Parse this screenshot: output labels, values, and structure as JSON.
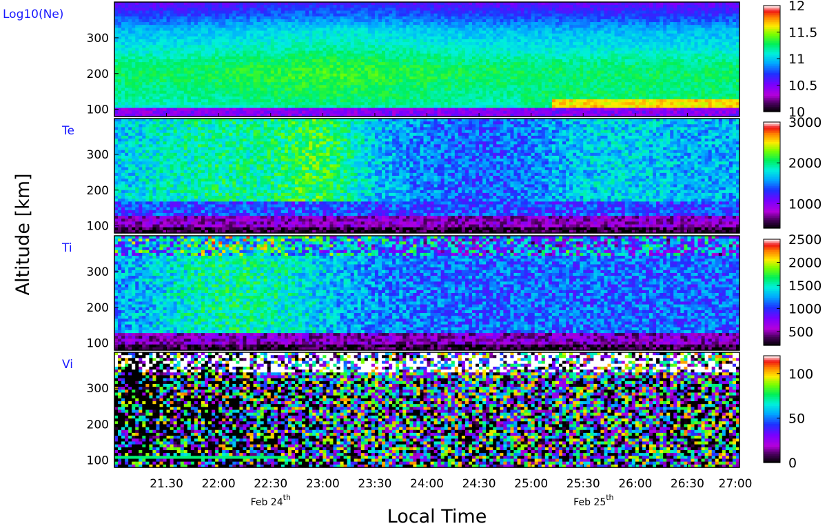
{
  "chart_data": {
    "type": "heatmap",
    "xlabel": "Local Time",
    "ylabel": "Altitude [km]",
    "x_range": [
      "21:00",
      "27:00"
    ],
    "x_ticks": [
      "21.30",
      "22:00",
      "22:30",
      "23:00",
      "23:30",
      "24:00",
      "24:30",
      "25:00",
      "25:30",
      "26:00",
      "26:30",
      "27:00"
    ],
    "x_tick_hours": [
      21.5,
      22,
      22.5,
      23,
      23.5,
      24,
      24.5,
      25,
      25.5,
      26,
      26.5,
      27
    ],
    "date_labels": [
      {
        "text": "Feb 24",
        "sup": "th",
        "at_hour": 22.5
      },
      {
        "text": "Feb 25",
        "sup": "th",
        "at_hour": 25.6
      }
    ],
    "panels": [
      {
        "name": "Log10(Ne)",
        "ylim": [
          80,
          400
        ],
        "y_ticks": [
          100,
          200,
          300
        ],
        "colorbar": {
          "range": [
            10,
            12
          ],
          "ticks": [
            10,
            10.5,
            11,
            11.5,
            12
          ],
          "tick_labels": [
            "10",
            "10.5",
            "11",
            "11.5",
            "12"
          ]
        }
      },
      {
        "name": "Te",
        "ylim": [
          80,
          400
        ],
        "y_ticks": [
          100,
          200,
          300
        ],
        "colorbar": {
          "range": [
            400,
            3000
          ],
          "ticks": [
            1000,
            2000,
            3000
          ],
          "tick_labels": [
            "1000",
            "2000",
            "3000"
          ]
        }
      },
      {
        "name": "Ti",
        "ylim": [
          80,
          400
        ],
        "y_ticks": [
          100,
          200,
          300
        ],
        "colorbar": {
          "range": [
            200,
            2500
          ],
          "ticks": [
            500,
            1000,
            1500,
            2000,
            2500
          ],
          "tick_labels": [
            "500",
            "1000",
            "1500",
            "2000",
            "2500"
          ]
        }
      },
      {
        "name": "Vi",
        "ylim": [
          80,
          400
        ],
        "y_ticks": [
          100,
          200,
          300
        ],
        "colorbar": {
          "range": [
            0,
            120
          ],
          "ticks": [
            0,
            50,
            100
          ],
          "tick_labels": [
            "0",
            "50",
            "100"
          ]
        }
      }
    ]
  }
}
